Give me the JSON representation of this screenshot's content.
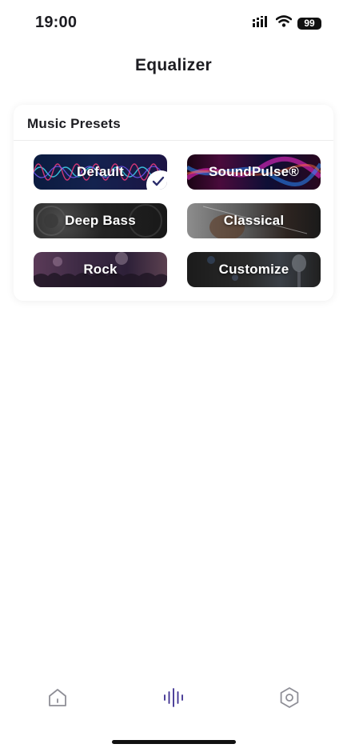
{
  "status_bar": {
    "time": "19:00",
    "battery": "99"
  },
  "header": {
    "title": "Equalizer"
  },
  "presets_card": {
    "title": "Music Presets",
    "presets": [
      {
        "label": "Default",
        "selected": true
      },
      {
        "label": "SoundPulse®",
        "selected": false
      },
      {
        "label": "Deep Bass",
        "selected": false
      },
      {
        "label": "Classical",
        "selected": false
      },
      {
        "label": "Rock",
        "selected": false
      },
      {
        "label": "Customize",
        "selected": false
      }
    ]
  },
  "tab_bar": {
    "tabs": [
      {
        "icon": "home-icon",
        "active": false
      },
      {
        "icon": "equalizer-icon",
        "active": true
      },
      {
        "icon": "settings-hexagon-icon",
        "active": false
      }
    ],
    "active_color": "#3b2d8f",
    "inactive_color": "#8e8e96"
  }
}
